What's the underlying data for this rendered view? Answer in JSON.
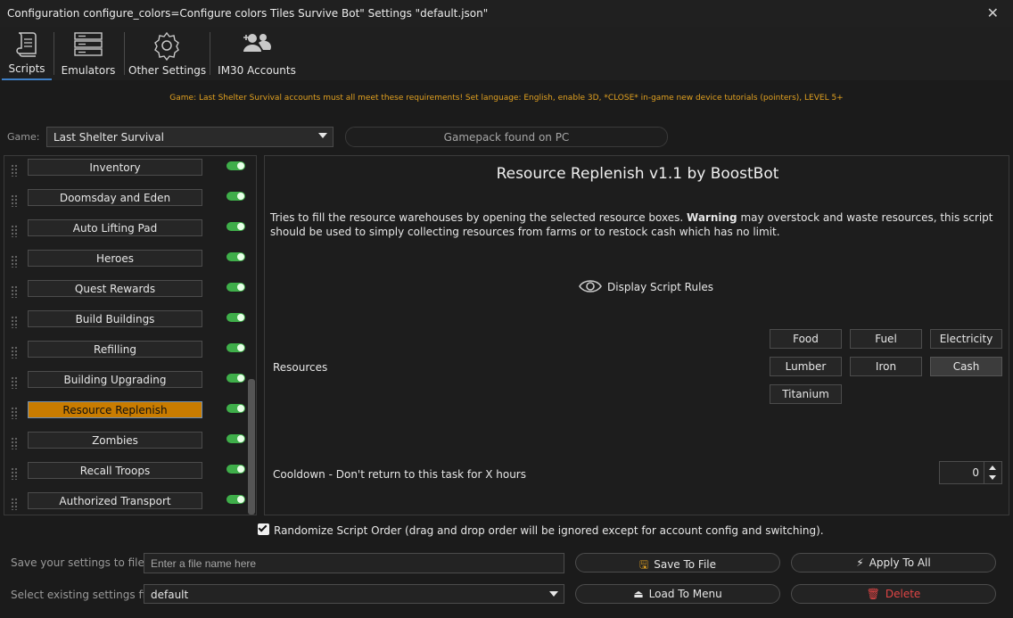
{
  "window": {
    "title": "Configuration configure_colors=Configure colors Tiles Survive Bot\" Settings \"default.json\"",
    "close_icon": "close-icon"
  },
  "tabs": [
    {
      "label": "Scripts",
      "icon": "scroll-icon",
      "active": true
    },
    {
      "label": "Emulators",
      "icon": "server-icon",
      "active": false
    },
    {
      "label": "Other Settings",
      "icon": "gear-icon",
      "active": false
    },
    {
      "label": "IM30 Accounts",
      "icon": "users-icon",
      "active": false
    }
  ],
  "notice": "Game: Last Shelter Survival accounts must all meet these requirements! Set language: English, enable 3D, *CLOSE* in-game new device tutorials (pointers), LEVEL 5+",
  "game": {
    "label": "Game:",
    "selected": "Last Shelter Survival",
    "gamepack_status": "Gamepack found on PC"
  },
  "scripts": [
    {
      "label": "Inventory",
      "enabled": true
    },
    {
      "label": "Doomsday and Eden",
      "enabled": true
    },
    {
      "label": "Auto Lifting Pad",
      "enabled": true
    },
    {
      "label": "Heroes",
      "enabled": true
    },
    {
      "label": "Quest Rewards",
      "enabled": true
    },
    {
      "label": "Build Buildings",
      "enabled": true
    },
    {
      "label": "Refilling",
      "enabled": true
    },
    {
      "label": "Building Upgrading",
      "enabled": true
    },
    {
      "label": "Resource Replenish",
      "enabled": true,
      "active": true
    },
    {
      "label": "Zombies",
      "enabled": true
    },
    {
      "label": "Recall Troops",
      "enabled": true
    },
    {
      "label": "Authorized Transport",
      "enabled": true
    }
  ],
  "panel": {
    "title": "Resource Replenish v1.1 by BoostBot",
    "desc_before": "Tries to fill the resource warehouses by opening the selected resource boxes. ",
    "desc_warning": "Warning",
    "desc_after": " may overstock and waste resources, this script should be used to simply collecting resources from farms or to restock cash which has no limit.",
    "display_rules": "Display Script Rules",
    "resources_label": "Resources",
    "resources": [
      {
        "label": "Food",
        "selected": false
      },
      {
        "label": "Fuel",
        "selected": false
      },
      {
        "label": "Electricity",
        "selected": false
      },
      {
        "label": "Lumber",
        "selected": false
      },
      {
        "label": "Iron",
        "selected": false
      },
      {
        "label": "Cash",
        "selected": true
      },
      {
        "label": "Titanium",
        "selected": false
      }
    ],
    "cooldown_label": "Cooldown - Don't return to this task for X hours",
    "cooldown_value": "0"
  },
  "randomize": {
    "checked": true,
    "label": "Randomize Script Order (drag and drop order will be ignored except for account config and switching)."
  },
  "settings": {
    "save_label": "Save your settings to file",
    "file_placeholder": "Enter a file name here",
    "save_button": "Save To File",
    "apply_button": "Apply To All",
    "select_label": "Select existing settings file",
    "selected_file": "default",
    "load_button": "Load To Menu",
    "delete_button": "Delete"
  },
  "colors": {
    "accent": "#c97c00",
    "notice": "#e0a020",
    "toggle_on": "#3fae4a",
    "danger": "#e04545",
    "tab_indicator": "#3e7fc6"
  }
}
